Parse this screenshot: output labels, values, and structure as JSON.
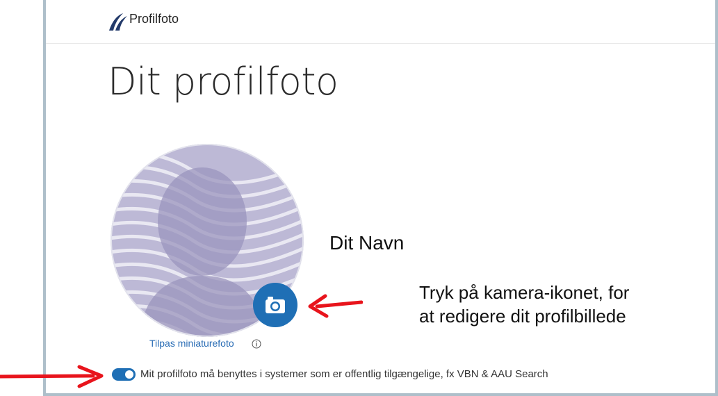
{
  "app": {
    "title": "Profilfoto",
    "logo_icon": "aau-wave-logo-icon"
  },
  "page": {
    "heading": "Dit profilfoto"
  },
  "profile": {
    "name": "Dit Navn",
    "avatar_icon": "default-person-silhouette-icon",
    "camera_icon": "camera-icon",
    "thumbnail_link": "Tilpas miniaturefoto",
    "info_icon": "info-icon"
  },
  "visibility": {
    "toggle_on": true,
    "label": "Mit profilfoto må benyttes i systemer som er offentlig tilgængelige, fx VBN & AAU Search"
  },
  "annotation": {
    "line1": "Tryk på kamera-ikonet, for",
    "line2": "at redigere dit profilbillede"
  },
  "colors": {
    "accent": "#1f6fb5",
    "annotation_arrow": "#e8141c",
    "avatar_background": "#bdb9d6",
    "avatar_silhouette": "#9b96bd",
    "frame_border": "#aebfca"
  }
}
